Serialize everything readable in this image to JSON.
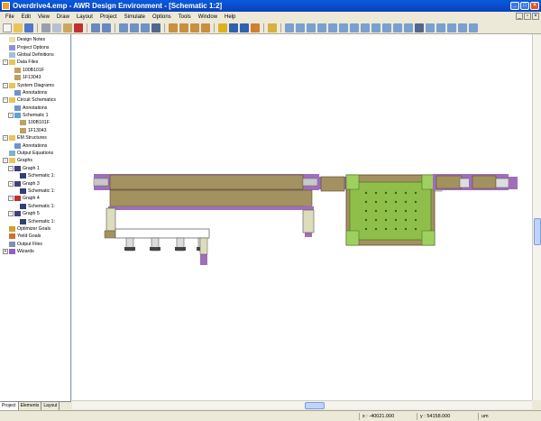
{
  "window": {
    "title": "Overdrive4.emp - AWR Design Environment - [Schematic 1:2]"
  },
  "menu": [
    "File",
    "Edit",
    "View",
    "Draw",
    "Layout",
    "Project",
    "Simulate",
    "Options",
    "Tools",
    "Window",
    "Help"
  ],
  "tree": [
    {
      "label": "Design Notes",
      "level": 0,
      "expander": "",
      "icon": "notes-icon"
    },
    {
      "label": "Project Options",
      "level": 0,
      "expander": "",
      "icon": "options-icon"
    },
    {
      "label": "Global Definitions",
      "level": 0,
      "expander": "",
      "icon": "definitions-icon"
    },
    {
      "label": "Data Files",
      "level": 0,
      "expander": "-",
      "icon": "folder-icon"
    },
    {
      "label": "100B101F",
      "level": 1,
      "expander": "",
      "icon": "data-file-icon"
    },
    {
      "label": "1F13043",
      "level": 1,
      "expander": "",
      "icon": "data-file-icon"
    },
    {
      "label": "System Diagrams",
      "level": 0,
      "expander": "-",
      "icon": "folder-icon"
    },
    {
      "label": "Annotations",
      "level": 1,
      "expander": "",
      "icon": "annotation-icon"
    },
    {
      "label": "Circuit Schematics",
      "level": 0,
      "expander": "-",
      "icon": "folder-icon"
    },
    {
      "label": "Annotations",
      "level": 1,
      "expander": "",
      "icon": "annotation-icon"
    },
    {
      "label": "Schematic 1",
      "level": 1,
      "expander": "-",
      "icon": "schematic-icon"
    },
    {
      "label": "100B101F",
      "level": 2,
      "expander": "",
      "icon": "data-file-icon"
    },
    {
      "label": "1F13043",
      "level": 2,
      "expander": "",
      "icon": "data-file-icon"
    },
    {
      "label": "EM Structures",
      "level": 0,
      "expander": "-",
      "icon": "folder-icon"
    },
    {
      "label": "Annotations",
      "level": 1,
      "expander": "",
      "icon": "annotation-icon"
    },
    {
      "label": "Output Equations",
      "level": 0,
      "expander": "",
      "icon": "equations-icon"
    },
    {
      "label": "Graphs",
      "level": 0,
      "expander": "-",
      "icon": "folder-icon"
    },
    {
      "label": "Graph 1",
      "level": 1,
      "expander": "-",
      "icon": "graph-icon"
    },
    {
      "label": "Schematic 1:",
      "level": 2,
      "expander": "",
      "icon": "measurement-icon"
    },
    {
      "label": "Graph 3",
      "level": 1,
      "expander": "-",
      "icon": "graph-icon"
    },
    {
      "label": "Schematic 1:",
      "level": 2,
      "expander": "",
      "icon": "measurement-icon"
    },
    {
      "label": "Graph 4",
      "level": 1,
      "expander": "-",
      "icon": "smith-chart-icon"
    },
    {
      "label": "Schematic 1:",
      "level": 2,
      "expander": "",
      "icon": "measurement-icon"
    },
    {
      "label": "Graph 5",
      "level": 1,
      "expander": "-",
      "icon": "graph-icon"
    },
    {
      "label": "Schematic 1:",
      "level": 2,
      "expander": "",
      "icon": "measurement-icon"
    },
    {
      "label": "Optimizer Goals",
      "level": 0,
      "expander": "",
      "icon": "optimizer-icon"
    },
    {
      "label": "Yield Goals",
      "level": 0,
      "expander": "",
      "icon": "yield-icon"
    },
    {
      "label": "Output Files",
      "level": 0,
      "expander": "",
      "icon": "output-files-icon"
    },
    {
      "label": "Wizards",
      "level": 0,
      "expander": "+",
      "icon": "wizard-icon"
    }
  ],
  "tabs": [
    "Project",
    "Elements",
    "Layout"
  ],
  "status": {
    "x": "x : -40021.000",
    "y": "y : 54158.000",
    "units": "um"
  },
  "colors": {
    "trace_fill": "#a39260",
    "trace_dark": "#86764a",
    "metal_edge": "#9e6fb8",
    "pad_green": "#8fbf4a",
    "bond_pad": "#ddddbc",
    "title_blue": "#0a5ade"
  }
}
